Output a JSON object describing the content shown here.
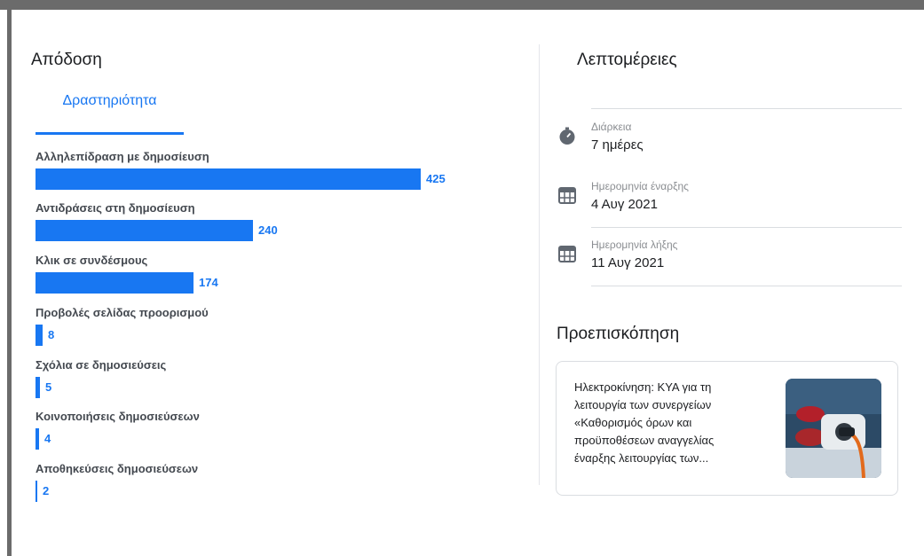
{
  "performance": {
    "title": "Απόδοση",
    "tab_label": "Δραστηριότητα",
    "metrics": [
      {
        "label": "Αλληλεπίδραση με δημοσίευση",
        "value": 425
      },
      {
        "label": "Αντιδράσεις στη δημοσίευση",
        "value": 240
      },
      {
        "label": "Κλικ σε συνδέσμους",
        "value": 174
      },
      {
        "label": "Προβολές σελίδας προορισμού",
        "value": 8
      },
      {
        "label": "Σχόλια σε δημοσιεύσεις",
        "value": 5
      },
      {
        "label": "Κοινοποιήσεις δημοσιεύσεων",
        "value": 4
      },
      {
        "label": "Αποθηκεύσεις δημοσιεύσεων",
        "value": 2
      }
    ]
  },
  "details": {
    "title": "Λεπτομέρειες",
    "items": [
      {
        "icon": "stopwatch-icon",
        "label": "Διάρκεια",
        "value": "7 ημέρες"
      },
      {
        "icon": "calendar-icon",
        "label": "Ημερομηνία έναρξης",
        "value": "4 Αυγ 2021"
      },
      {
        "icon": "calendar-icon",
        "label": "Ημερομηνία λήξης",
        "value": "11 Αυγ 2021"
      }
    ]
  },
  "preview": {
    "title": "Προεπισκόπηση",
    "text": "Ηλεκτροκίνηση: ΚΥΑ για τη λειτουργία των συνεργείων «Καθορισμός όρων και προϋποθέσεων αναγγελίας έναρξης λειτουργίας των...",
    "thumbnail": "ev-charging-photo"
  },
  "colors": {
    "accent": "#1877f2",
    "frame": "#6b6b6b",
    "icon": "#606770"
  }
}
